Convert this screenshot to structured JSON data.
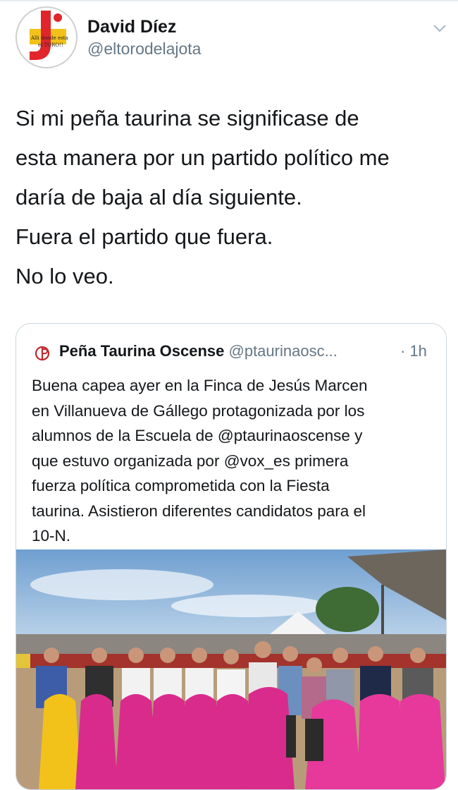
{
  "tweet": {
    "author": {
      "name": "David Díez",
      "handle": "@eltorodelajota",
      "avatar_icon": "bull-logo-avatar"
    },
    "menu_icon": "chevron-down-icon",
    "text_lines": [
      "Si mi peña taurina se significase de",
      "esta manera por un partido político me",
      "daría de baja al día siguiente.",
      "Fuera el partido que fuera.",
      "No lo veo."
    ]
  },
  "quoted": {
    "author": {
      "name": "Peña Taurina Oscense",
      "handle": "@ptaurinaosc...",
      "logo_icon": "club-logo-icon"
    },
    "time": "· 1h",
    "text_lines": [
      "Buena capea ayer en la Finca de Jesús Marcen",
      "en Villanueva de Gállego protagonizada por los",
      "alumnos de la Escuela de @ptaurinaoscense y",
      "que estuvo organizada por @vox_es primera",
      "fuerza política comprometida con la Fiesta",
      "taurina. Asistieron diferentes candidatos para el",
      "10-N."
    ],
    "photo": {
      "description_icon": "group-photo-bullring"
    }
  },
  "colors": {
    "text": "#14171a",
    "secondary": "#657786",
    "border": "#ccd6dd",
    "capote_pink": "#d92b8c",
    "capote_yellow": "#f2c21b"
  }
}
